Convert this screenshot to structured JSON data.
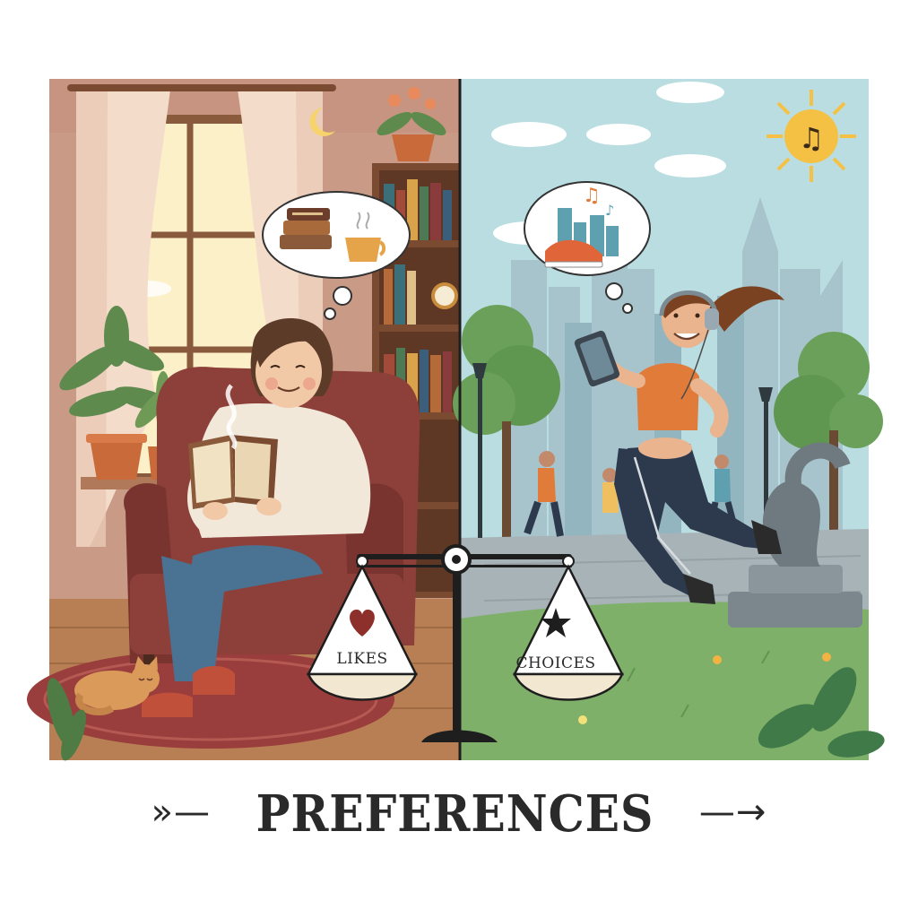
{
  "scale": {
    "left_label": "LIKES",
    "right_label": "CHOICES"
  },
  "caption": {
    "title": "PREFERENCES",
    "left_arrow": "»—",
    "right_arrow": "—→"
  },
  "palette": {
    "room_wall": "#c99a86",
    "sky": "#b9dde0",
    "grass": "#7fb06a",
    "armchair": "#8d3f3a",
    "sweater": "#f2e8da",
    "jeans": "#4a7393",
    "top_orange": "#e07b3a",
    "leggings": "#2d3a4e",
    "sun": "#f5c144"
  },
  "icons": [
    "moon-icon",
    "sun-music-icon",
    "heart-icon",
    "star-icon",
    "books-icon",
    "coffee-cup-icon",
    "sneaker-icon",
    "music-notes-icon"
  ]
}
